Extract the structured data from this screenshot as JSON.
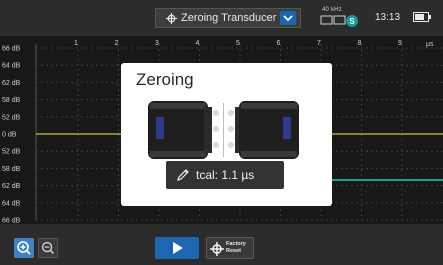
{
  "header": {
    "mode_label": "Zeroing Transducer",
    "frequency": "40 kHz",
    "probe_badge": "S",
    "clock": "13:13"
  },
  "plot": {
    "x_unit": "µs",
    "x_ticks": [
      "1",
      "2",
      "3",
      "4",
      "5",
      "6",
      "7",
      "8",
      "9"
    ],
    "y_ticks": [
      "66 dB",
      "64 dB",
      "62 dB",
      "58 dB",
      "52 dB",
      "0 dB",
      "52 dB",
      "58 dB",
      "62 dB",
      "64 dB",
      "66 dB"
    ],
    "trace_color": "#c9c23a",
    "grid_color": "#3a3a3a"
  },
  "dialog": {
    "title": "Zeroing",
    "tcal": "tcal: 1.1 µs"
  },
  "toolbar": {
    "factory_reset_label_1": "Factory",
    "factory_reset_label_2": "Reset"
  },
  "colors": {
    "accent": "#1d66b2",
    "teal": "#129c9a"
  }
}
